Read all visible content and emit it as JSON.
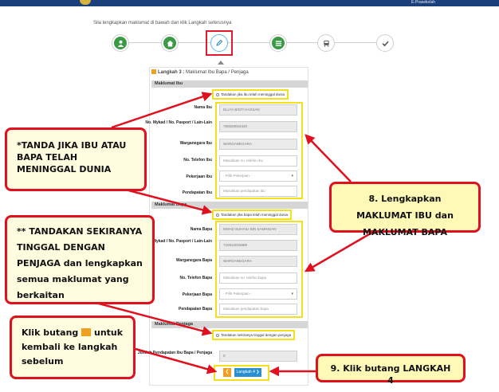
{
  "header": {
    "brand": "E-Prasekolah"
  },
  "instruction": "Sila lengkapkan maklumat di bawah dan klik Langkah seterusnya",
  "steps": [
    {
      "icon": "user-icon"
    },
    {
      "icon": "home-icon"
    },
    {
      "icon": "pencil-icon"
    },
    {
      "icon": "list-icon"
    },
    {
      "icon": "bus-icon"
    },
    {
      "icon": "check-icon"
    }
  ],
  "form": {
    "step_label": "Langkah 3 :",
    "step_title": "Maklumat Ibu Bapa / Penjaga",
    "ibu": {
      "section": "Maklumat Ibu",
      "checkbox": "Tandakan jika ibu telah meninggal dunia",
      "fields": [
        {
          "label": "Nama Ibu",
          "value": "ELLYA BINTI HASSAN"
        },
        {
          "label": "No. Mykad / No. Pasport / Lain-Lain",
          "value": "780528016420"
        },
        {
          "label": "Warganegara Ibu",
          "value": "WARGANEGARA"
        },
        {
          "label": "No. Telefon Ibu",
          "placeholder": "Masukkan no. telefon ibu"
        },
        {
          "label": "Pekerjaan Ibu",
          "placeholder": "- Pilih Pekerjaan -"
        },
        {
          "label": "Pendapatan Ibu",
          "placeholder": "Masukkan pendapatan ibu"
        }
      ]
    },
    "bapa": {
      "section": "Maklumat Bapa",
      "checkbox": "Tandakan jika bapa telah meninggal dunia",
      "fields": [
        {
          "label": "Nama Bapa",
          "value": "MOHD SUHAILI BIN SAMINGAN"
        },
        {
          "label": "No. Mykad / No. Pasport / Lain-Lain",
          "value": "710812015869"
        },
        {
          "label": "Warganegara Bapa",
          "value": "WARGANEGARA"
        },
        {
          "label": "No. Telefon Bapa",
          "placeholder": "Masukkan no. telefon bapa"
        },
        {
          "label": "Pekerjaan Bapa",
          "placeholder": "- Pilih Pekerjaan -"
        },
        {
          "label": "Pendapatan Bapa",
          "placeholder": "Masukkan pendapatan bapa"
        }
      ]
    },
    "penjaga": {
      "section": "Maklumat Penjaga",
      "checkbox": "Tandakan sekiranya tinggal dengan penjaga"
    },
    "income": {
      "label": "Jumlah Pendapatan Ibu Bapa / Penjaga",
      "value": "0"
    },
    "next_label": "Langkah 4 ❯",
    "back_label": "❮"
  },
  "callouts": {
    "deceased": "*TANDA JIKA IBU ATAU BAPA TELAH MENINGGAL DUNIA",
    "guardian": "** TANDAKAN SEKIRANYA TINGGAL DENGAN PENJAGA dan lengkapkan semua maklumat yang berkaitan",
    "back_pre": "Klik butang",
    "back_post": "untuk kembali ke langkah sebelum",
    "complete": "8. Lengkapkan MAKLUMAT IBU dan MAKLUMAT BAPA",
    "next": "9. Klik butang LANGKAH 4"
  },
  "colors": {
    "accent": "#e0101e",
    "highlight": "#f2e01e",
    "primary": "#2a8fd0",
    "step_done": "#3a9a45",
    "back": "#f0a020"
  }
}
